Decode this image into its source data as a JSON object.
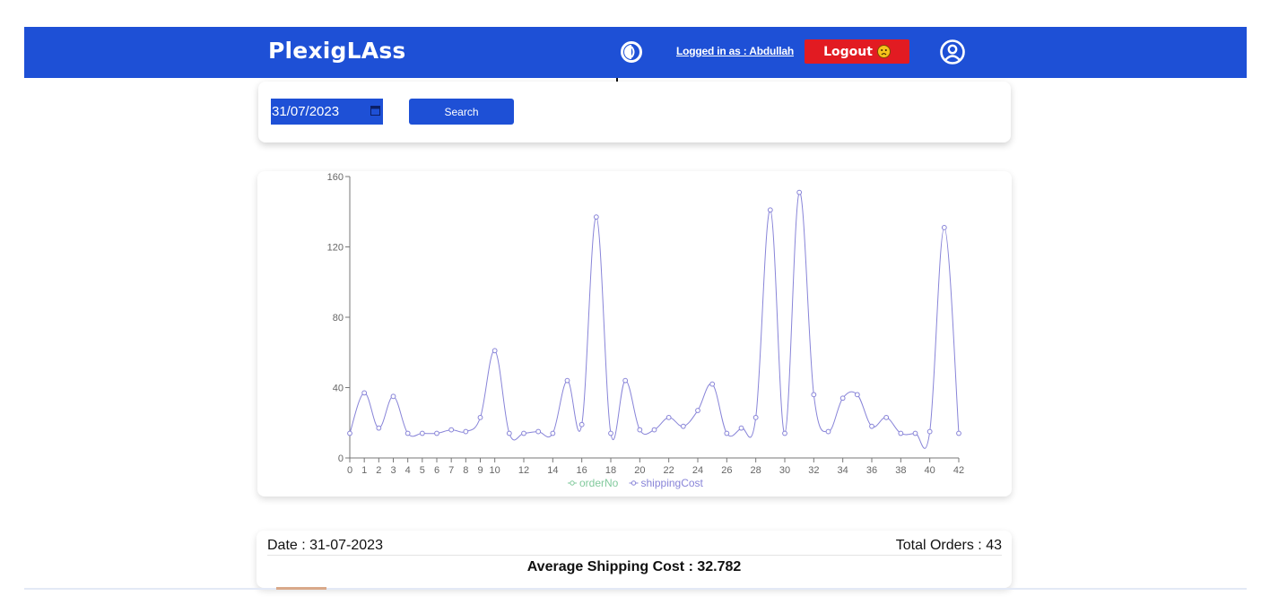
{
  "navbar": {
    "brand": "PlexigLAss",
    "logged_in_text": "Logged in as : Abdullah",
    "logout_label": "Logout",
    "logout_emoji_icon": "frown-emoji-icon",
    "theme_icon": "contrast-icon",
    "profile_icon": "user-circle-icon",
    "bg_color": "#1e50d6",
    "logout_color": "#e21b22"
  },
  "search": {
    "date_value": "31/07/2023",
    "button_label": "Search",
    "calendar_icon": "calendar-icon"
  },
  "chart_data": {
    "type": "line",
    "x": [
      0,
      1,
      2,
      3,
      4,
      5,
      6,
      7,
      8,
      9,
      10,
      11,
      12,
      13,
      14,
      15,
      16,
      17,
      18,
      19,
      20,
      21,
      22,
      23,
      24,
      25,
      26,
      27,
      28,
      29,
      30,
      31,
      32,
      33,
      34,
      35,
      36,
      37,
      38,
      39,
      40,
      41,
      42
    ],
    "xticks": [
      "0",
      "1",
      "2",
      "3",
      "4",
      "5",
      "6",
      "7",
      "8",
      "9",
      "10",
      "12",
      "14",
      "16",
      "18",
      "20",
      "22",
      "24",
      "26",
      "28",
      "30",
      "32",
      "34",
      "36",
      "38",
      "40",
      "42"
    ],
    "yticks": [
      "0",
      "40",
      "80",
      "120",
      "160"
    ],
    "ylim": [
      0,
      160
    ],
    "series": [
      {
        "name": "orderNo",
        "color": "#82ca9d",
        "values": []
      },
      {
        "name": "shippingCost",
        "color": "#8884d8",
        "values": [
          14,
          37,
          17,
          35,
          14,
          14,
          14,
          16,
          15,
          23,
          61,
          14,
          14,
          15,
          14,
          44,
          19,
          137,
          14,
          44,
          16,
          16,
          23,
          18,
          27,
          42,
          14,
          17,
          23,
          141,
          14,
          151,
          36,
          15,
          34,
          36,
          18,
          23,
          14,
          14,
          15,
          131,
          14
        ]
      }
    ],
    "legend_position": "bottom-center",
    "grid": false
  },
  "summary": {
    "date": "Date : 31-07-2023",
    "total_orders": "Total Orders : 43",
    "average": "Average Shipping Cost : 32.782"
  }
}
